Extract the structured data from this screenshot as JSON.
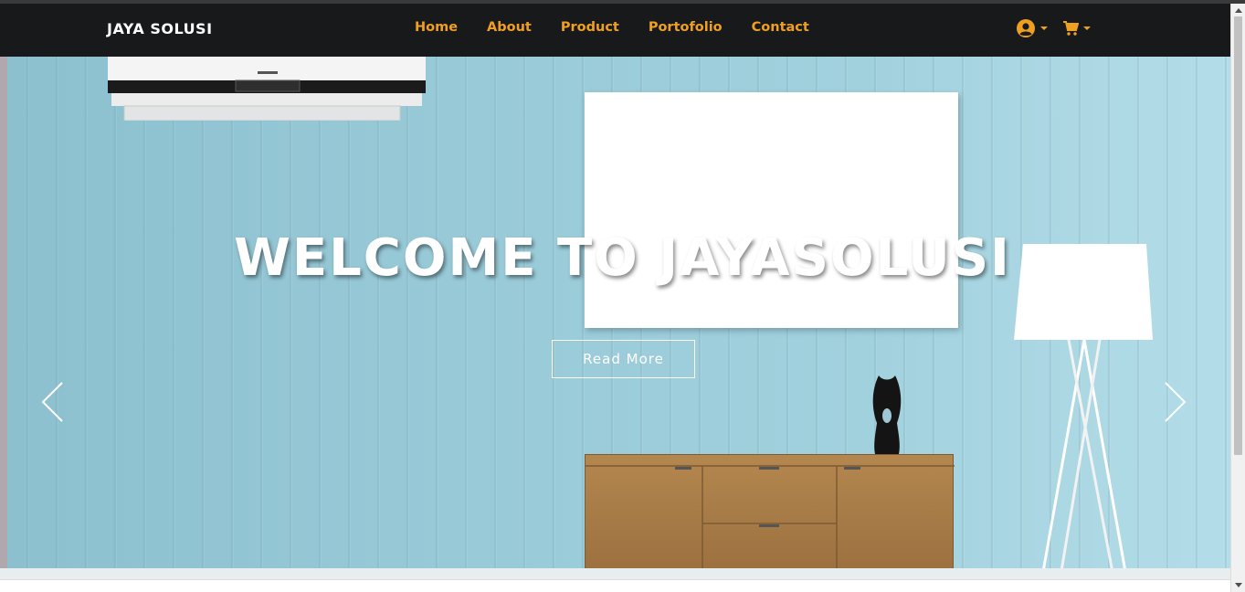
{
  "brand": {
    "name": "JAYA SOLUSI"
  },
  "nav": {
    "links": [
      "Home",
      "About",
      "Product",
      "Portofolio",
      "Contact"
    ],
    "icons": {
      "account": "user-circle-icon",
      "cart": "shopping-cart-icon"
    }
  },
  "hero": {
    "headline": "WELCOME TO JAYASOLUSI",
    "cta_label": "Read More",
    "prev_icon": "chevron-left-icon",
    "next_icon": "chevron-right-icon"
  },
  "colors": {
    "navbar": "#18191b",
    "nav_link": "#f0a020",
    "brand_text": "#ffffff",
    "hero_wall": "#9ccbd8"
  }
}
